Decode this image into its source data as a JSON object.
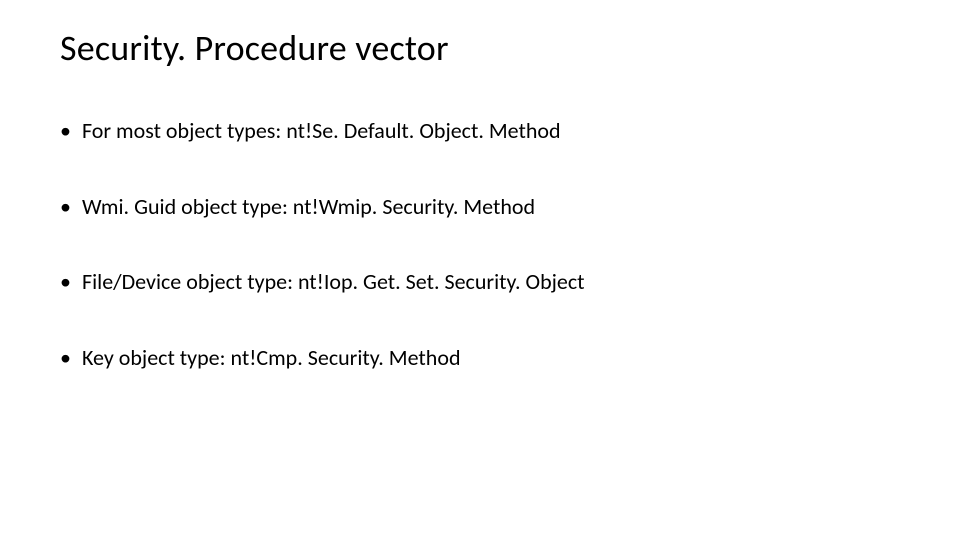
{
  "slide": {
    "title": "Security. Procedure vector",
    "bullets": [
      "For most object types: nt!Se. Default. Object. Method",
      "Wmi. Guid object type: nt!Wmip. Security. Method",
      "File/Device object type: nt!Iop. Get. Set. Security. Object",
      "Key object type: nt!Cmp. Security. Method"
    ]
  }
}
